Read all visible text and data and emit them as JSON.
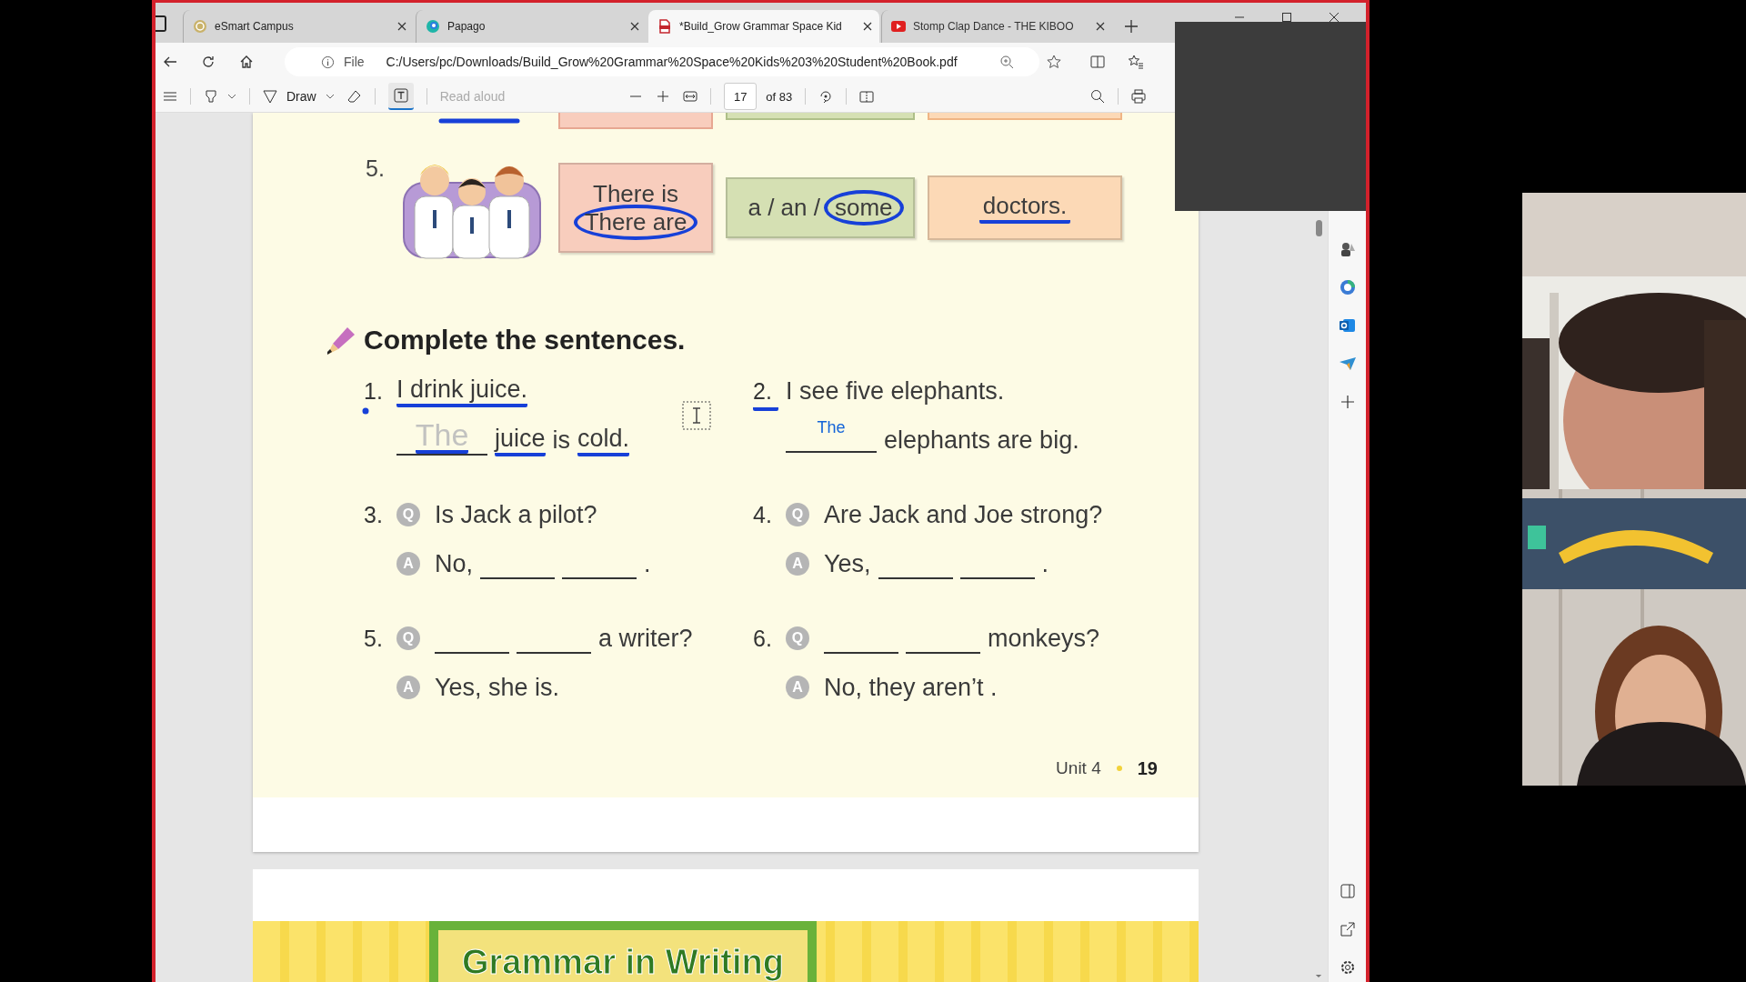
{
  "browser": {
    "tabs": [
      {
        "label": "eSmart Campus",
        "kind": "site",
        "selected": false
      },
      {
        "label": "Papago",
        "kind": "translate",
        "selected": false
      },
      {
        "label": "*Build_Grow Grammar Space Kid",
        "kind": "pdf",
        "selected": true
      },
      {
        "label": "Stomp Clap Dance - THE KIBOO",
        "kind": "video",
        "selected": false
      }
    ],
    "address": {
      "scheme": "File",
      "url": "C:/Users/pc/Downloads/Build_Grow%20Grammar%20Space%20Kids%203%20Student%20Book.pdf"
    },
    "toolbar": {
      "draw": "Draw",
      "text_tool_selected": true,
      "read_aloud": {
        "label": "Read aloud",
        "disabled": true
      },
      "page_number": "17",
      "page_total": "of 83"
    }
  },
  "page": {
    "exercise": {
      "number": "5.",
      "boxes": [
        {
          "color": "#f8cdbd",
          "lines": [
            [
              {
                "text": "There is",
                "circled": false,
                "underlined": false
              }
            ],
            [
              {
                "text": "There are",
                "circled": true,
                "underlined": false
              }
            ]
          ]
        },
        {
          "color": "#d5e0b3",
          "lines": [
            [
              {
                "text": "a / an /",
                "circled": false,
                "underlined": false
              },
              {
                "text": "some",
                "circled": true,
                "underlined": false
              }
            ]
          ]
        },
        {
          "color": "#fcd9b6",
          "lines": [
            [
              {
                "text": "doctors.",
                "circled": false,
                "underlined": true
              }
            ]
          ]
        }
      ]
    },
    "section_title": "Complete the sentences.",
    "items": [
      {
        "number": "1.",
        "number_underlined": false,
        "lines": [
          {
            "segments": [
              {
                "kind": "text",
                "text": "I drink juice.",
                "underlined": true
              }
            ]
          },
          {
            "segments": [
              {
                "kind": "handwritten",
                "text": "The"
              },
              {
                "kind": "text",
                "text": "juice",
                "underlined": true
              },
              {
                "kind": "text",
                "text": "is",
                "underlined": false
              },
              {
                "kind": "text",
                "text": "cold.",
                "underlined": true
              }
            ]
          }
        ]
      },
      {
        "number": "2.",
        "number_underlined": true,
        "lines": [
          {
            "segments": [
              {
                "kind": "text",
                "text": "I see five elephants.",
                "underlined": false
              }
            ]
          },
          {
            "segments": [
              {
                "kind": "typed",
                "text": "The"
              },
              {
                "kind": "text",
                "text": "elephants are big.",
                "underlined": false
              }
            ]
          }
        ]
      },
      {
        "number": "3.",
        "number_underlined": false,
        "lines": [
          {
            "badge": "Q",
            "segments": [
              {
                "kind": "text",
                "text": "Is Jack a pilot?",
                "underlined": false
              }
            ]
          },
          {
            "badge": "A",
            "segments": [
              {
                "kind": "text",
                "text": "No,",
                "underlined": false
              },
              {
                "kind": "blank"
              },
              {
                "kind": "blank"
              },
              {
                "kind": "text",
                "text": ".",
                "underlined": false
              }
            ]
          }
        ]
      },
      {
        "number": "4.",
        "number_underlined": false,
        "lines": [
          {
            "badge": "Q",
            "segments": [
              {
                "kind": "text",
                "text": "Are Jack and Joe strong?",
                "underlined": false
              }
            ]
          },
          {
            "badge": "A",
            "segments": [
              {
                "kind": "text",
                "text": "Yes,",
                "underlined": false
              },
              {
                "kind": "blank"
              },
              {
                "kind": "blank"
              },
              {
                "kind": "text",
                "text": ".",
                "underlined": false
              }
            ]
          }
        ]
      },
      {
        "number": "5.",
        "number_underlined": false,
        "lines": [
          {
            "badge": "Q",
            "segments": [
              {
                "kind": "blank"
              },
              {
                "kind": "blank"
              },
              {
                "kind": "text",
                "text": "a writer?",
                "underlined": false
              }
            ]
          },
          {
            "badge": "A",
            "segments": [
              {
                "kind": "text",
                "text": "Yes, she is.",
                "underlined": false
              }
            ]
          }
        ]
      },
      {
        "number": "6.",
        "number_underlined": false,
        "lines": [
          {
            "badge": "Q",
            "segments": [
              {
                "kind": "blank"
              },
              {
                "kind": "blank"
              },
              {
                "kind": "text",
                "text": "monkeys?",
                "underlined": false
              }
            ]
          },
          {
            "badge": "A",
            "segments": [
              {
                "kind": "text",
                "text": "No, they aren’t .",
                "underlined": false
              }
            ]
          }
        ]
      }
    ],
    "footer": {
      "unit": "Unit 4",
      "page": "19"
    }
  },
  "next_page": {
    "banner": "Grammar in Writing"
  }
}
